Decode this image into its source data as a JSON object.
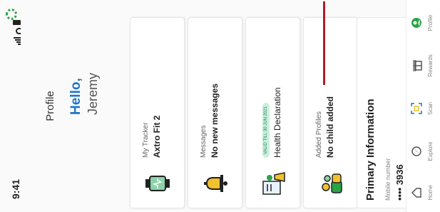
{
  "status": {
    "time": "9:41"
  },
  "header": {
    "title": "Profile"
  },
  "greeting": {
    "hello": "Hello,",
    "name": "Jeremy"
  },
  "cards": [
    {
      "small": "My Tracker",
      "big": "Axtro Fit 2",
      "icon": "watch-icon"
    },
    {
      "small": "Messages",
      "big": "No new messages",
      "icon": "bell-icon"
    },
    {
      "badge": "VALID TILL 30 JUN 2021",
      "big": "Health Declaration",
      "icon": "health-declaration-icon"
    },
    {
      "small": "Added Profiles",
      "big": "No child added",
      "icon": "profiles-icon"
    }
  ],
  "primary": {
    "heading": "Primary Information",
    "mobile_label": "Mobile number",
    "mobile_value": "•••• 3936"
  },
  "nav": [
    "Home",
    "Explore",
    "Scan",
    "Rewards",
    "Profile"
  ],
  "colors": {
    "accent": "#1e74c9",
    "green": "#2aa447",
    "badge": "#c9f0de",
    "red_line": "#b01b2c"
  }
}
